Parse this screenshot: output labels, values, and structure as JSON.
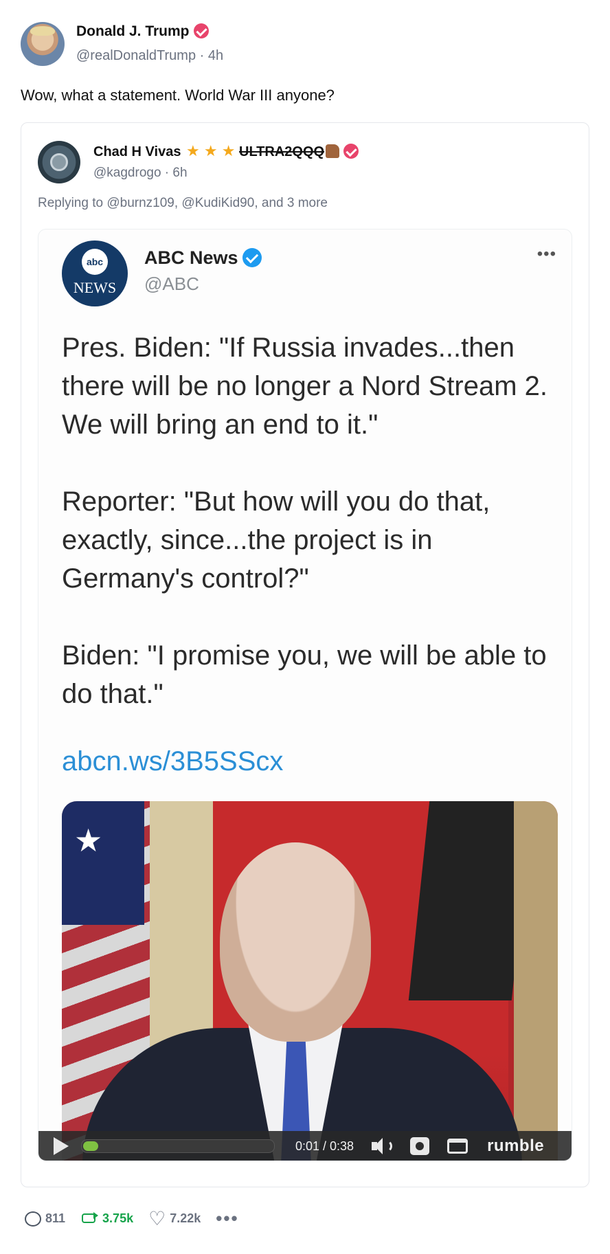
{
  "author": {
    "name": "Donald J. Trump",
    "handle_line": "@realDonaldTrump · 4h"
  },
  "status_text": "Wow, what a statement. World War III anyone?",
  "quote": {
    "name": "Chad H Vivas",
    "stars": "★ ★ ★",
    "tag": "ULTRA2QQQ",
    "handle_line": "@kagdrogo · 6h",
    "replying_to": "Replying to @burnz109, @KudiKid90, and 3 more",
    "embed": {
      "logo_top": "abc",
      "logo_bottom": "NEWS",
      "name": "ABC News",
      "handle": "@ABC",
      "more": "•••",
      "paragraphs": [
        "Pres. Biden: \"If Russia invades...then there will be no longer a Nord Stream 2. We will bring an end to it.\"",
        "Reporter: \"But how will you do that, exactly, since...the project is in Germany's control?\"",
        "Biden: \"I promise you, we will be able to do that.\""
      ],
      "link": "abcn.ws/3B5SScx"
    },
    "video": {
      "time": "0:01 / 0:38",
      "progress_fraction": 0.026,
      "brand": "rumble"
    }
  },
  "actions": {
    "replies": "811",
    "reposts": "3.75k",
    "likes": "7.22k",
    "more": "•••"
  },
  "colors": {
    "verified_badge": "#e8446b",
    "abc_verified": "#1d9bf0",
    "link": "#2b8fd6",
    "repost": "#16a34a",
    "progress": "#7fc142"
  }
}
